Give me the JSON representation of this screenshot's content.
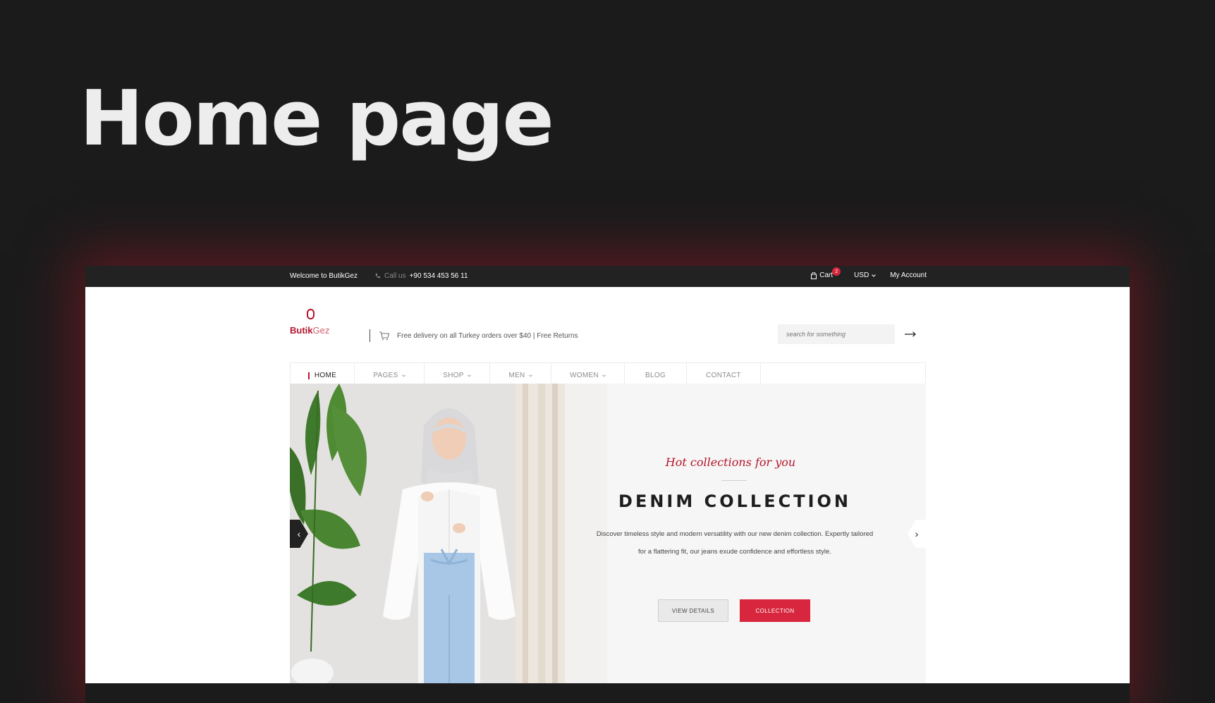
{
  "slide": {
    "heading": "Home page"
  },
  "topbar": {
    "welcome": "Welcome to ButikGez",
    "call_label": "Call us",
    "phone": "+90 534 453 56 11",
    "cart_label": "Cart",
    "cart_count": "2",
    "currency": "USD",
    "account": "My Account"
  },
  "header": {
    "logo_main": "Butik",
    "logo_accent": "Gez",
    "promo": "Free delivery on all Turkey orders over $40 | Free Returns",
    "search_placeholder": "search for something"
  },
  "nav": {
    "items": [
      {
        "label": "HOME",
        "dropdown": false,
        "active": true
      },
      {
        "label": "PAGES",
        "dropdown": true
      },
      {
        "label": "SHOP",
        "dropdown": true
      },
      {
        "label": "MEN",
        "dropdown": true
      },
      {
        "label": "WOMEN",
        "dropdown": true
      },
      {
        "label": "BLOG",
        "dropdown": false
      },
      {
        "label": "CONTACT",
        "dropdown": false
      }
    ]
  },
  "hero": {
    "tagline": "Hot collections for you",
    "title": "DENIM COLLECTION",
    "description_line1": "Discover timeless style and modern versatility with our new denim collection. Expertly tailored",
    "description_line2": "for a flattering fit, our jeans exude confidence and effortless style.",
    "primary_button": "VIEW DETAILS",
    "secondary_button": "COLLECTION"
  },
  "colors": {
    "accent": "#d7263d",
    "brand": "#b5142b",
    "topbar": "#222222",
    "hero_bg": "#f6f6f6"
  },
  "icons": {
    "phone": "phone-icon",
    "cart": "cart-icon",
    "delivery": "shopping-cart-icon",
    "search_submit": "arrow-right-icon",
    "prev": "chevron-left-icon",
    "next": "chevron-right-icon"
  }
}
